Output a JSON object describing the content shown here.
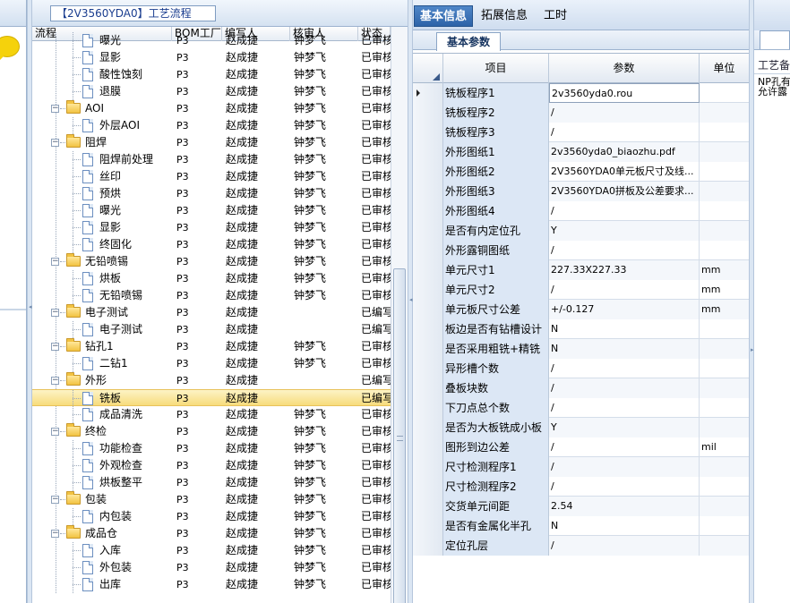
{
  "tree_pane": {
    "title": "【2V3560YDA0】工艺流程",
    "columns": [
      "流程",
      "BOM工厂",
      "编写人",
      "核审人",
      "状态"
    ],
    "rows": [
      {
        "name": "曝光",
        "level": 2,
        "bom": "P3",
        "writer": "赵成捷",
        "checker": "钟梦飞",
        "status": "已审核"
      },
      {
        "name": "显影",
        "level": 2,
        "bom": "P3",
        "writer": "赵成捷",
        "checker": "钟梦飞",
        "status": "已审核"
      },
      {
        "name": "酸性蚀刻",
        "level": 2,
        "bom": "P3",
        "writer": "赵成捷",
        "checker": "钟梦飞",
        "status": "已审核"
      },
      {
        "name": "退膜",
        "level": 2,
        "bom": "P3",
        "writer": "赵成捷",
        "checker": "钟梦飞",
        "status": "已审核"
      },
      {
        "name": "AOI",
        "level": 1,
        "bom": "P3",
        "writer": "赵成捷",
        "checker": "钟梦飞",
        "status": "已审核"
      },
      {
        "name": "外层AOI",
        "level": 2,
        "bom": "P3",
        "writer": "赵成捷",
        "checker": "钟梦飞",
        "status": "已审核"
      },
      {
        "name": "阻焊",
        "level": 1,
        "bom": "P3",
        "writer": "赵成捷",
        "checker": "钟梦飞",
        "status": "已审核"
      },
      {
        "name": "阻焊前处理",
        "level": 2,
        "bom": "P3",
        "writer": "赵成捷",
        "checker": "钟梦飞",
        "status": "已审核"
      },
      {
        "name": "丝印",
        "level": 2,
        "bom": "P3",
        "writer": "赵成捷",
        "checker": "钟梦飞",
        "status": "已审核"
      },
      {
        "name": "预烘",
        "level": 2,
        "bom": "P3",
        "writer": "赵成捷",
        "checker": "钟梦飞",
        "status": "已审核"
      },
      {
        "name": "曝光",
        "level": 2,
        "bom": "P3",
        "writer": "赵成捷",
        "checker": "钟梦飞",
        "status": "已审核"
      },
      {
        "name": "显影",
        "level": 2,
        "bom": "P3",
        "writer": "赵成捷",
        "checker": "钟梦飞",
        "status": "已审核"
      },
      {
        "name": "终固化",
        "level": 2,
        "bom": "P3",
        "writer": "赵成捷",
        "checker": "钟梦飞",
        "status": "已审核"
      },
      {
        "name": "无铅喷锡",
        "level": 1,
        "bom": "P3",
        "writer": "赵成捷",
        "checker": "钟梦飞",
        "status": "已审核"
      },
      {
        "name": "烘板",
        "level": 2,
        "bom": "P3",
        "writer": "赵成捷",
        "checker": "钟梦飞",
        "status": "已审核"
      },
      {
        "name": "无铅喷锡",
        "level": 2,
        "bom": "P3",
        "writer": "赵成捷",
        "checker": "钟梦飞",
        "status": "已审核"
      },
      {
        "name": "电子测试",
        "level": 1,
        "bom": "P3",
        "writer": "赵成捷",
        "checker": "",
        "status": "已编写"
      },
      {
        "name": "电子测试",
        "level": 2,
        "bom": "P3",
        "writer": "赵成捷",
        "checker": "",
        "status": "已编写"
      },
      {
        "name": "钻孔1",
        "level": 1,
        "bom": "P3",
        "writer": "赵成捷",
        "checker": "钟梦飞",
        "status": "已审核"
      },
      {
        "name": "二钻1",
        "level": 2,
        "bom": "P3",
        "writer": "赵成捷",
        "checker": "钟梦飞",
        "status": "已审核"
      },
      {
        "name": "外形",
        "level": 1,
        "bom": "P3",
        "writer": "赵成捷",
        "checker": "",
        "status": "已编写"
      },
      {
        "name": "铣板",
        "level": 2,
        "bom": "P3",
        "writer": "赵成捷",
        "checker": "",
        "status": "已编写",
        "selected": true
      },
      {
        "name": "成品清洗",
        "level": 2,
        "bom": "P3",
        "writer": "赵成捷",
        "checker": "钟梦飞",
        "status": "已审核"
      },
      {
        "name": "终检",
        "level": 1,
        "bom": "P3",
        "writer": "赵成捷",
        "checker": "钟梦飞",
        "status": "已审核"
      },
      {
        "name": "功能检查",
        "level": 2,
        "bom": "P3",
        "writer": "赵成捷",
        "checker": "钟梦飞",
        "status": "已审核"
      },
      {
        "name": "外观检查",
        "level": 2,
        "bom": "P3",
        "writer": "赵成捷",
        "checker": "钟梦飞",
        "status": "已审核"
      },
      {
        "name": "烘板整平",
        "level": 2,
        "bom": "P3",
        "writer": "赵成捷",
        "checker": "钟梦飞",
        "status": "已审核"
      },
      {
        "name": "包装",
        "level": 1,
        "bom": "P3",
        "writer": "赵成捷",
        "checker": "钟梦飞",
        "status": "已审核"
      },
      {
        "name": "内包装",
        "level": 2,
        "bom": "P3",
        "writer": "赵成捷",
        "checker": "钟梦飞",
        "status": "已审核"
      },
      {
        "name": "成品仓",
        "level": 1,
        "bom": "P3",
        "writer": "赵成捷",
        "checker": "钟梦飞",
        "status": "已审核"
      },
      {
        "name": "入库",
        "level": 2,
        "bom": "P3",
        "writer": "赵成捷",
        "checker": "钟梦飞",
        "status": "已审核"
      },
      {
        "name": "外包装",
        "level": 2,
        "bom": "P3",
        "writer": "赵成捷",
        "checker": "钟梦飞",
        "status": "已审核"
      },
      {
        "name": "出库",
        "level": 2,
        "bom": "P3",
        "writer": "赵成捷",
        "checker": "钟梦飞",
        "status": "已审核"
      }
    ]
  },
  "right_pane": {
    "tabs": [
      "基本信息",
      "拓展信息",
      "工时"
    ],
    "sub_tab": "基本参数",
    "grid_columns": [
      "项目",
      "参数",
      "单位"
    ],
    "rows": [
      {
        "item": "铣板程序1",
        "value": "2v3560yda0.rou",
        "unit": ""
      },
      {
        "item": "铣板程序2",
        "value": "/",
        "unit": ""
      },
      {
        "item": "铣板程序3",
        "value": "/",
        "unit": ""
      },
      {
        "item": "外形图纸1",
        "value": "2v3560yda0_biaozhu.pdf",
        "unit": ""
      },
      {
        "item": "外形图纸2",
        "value": "2V3560YDA0单元板尺寸及线...",
        "unit": ""
      },
      {
        "item": "外形图纸3",
        "value": "2V3560YDA0拼板及公差要求...",
        "unit": ""
      },
      {
        "item": "外形图纸4",
        "value": "/",
        "unit": ""
      },
      {
        "item": "是否有内定位孔",
        "value": "Y",
        "unit": ""
      },
      {
        "item": "外形露铜图纸",
        "value": "/",
        "unit": ""
      },
      {
        "item": "单元尺寸1",
        "value": "227.33X227.33",
        "unit": "mm"
      },
      {
        "item": "单元尺寸2",
        "value": "/",
        "unit": "mm"
      },
      {
        "item": "单元板尺寸公差",
        "value": "+/-0.127",
        "unit": "mm"
      },
      {
        "item": "板边是否有钻槽设计",
        "value": "N",
        "unit": ""
      },
      {
        "item": "是否采用粗铣+精铣",
        "value": "N",
        "unit": ""
      },
      {
        "item": "异形槽个数",
        "value": "/",
        "unit": ""
      },
      {
        "item": "叠板块数",
        "value": "/",
        "unit": ""
      },
      {
        "item": "下刀点总个数",
        "value": "/",
        "unit": ""
      },
      {
        "item": "是否为大板铣成小板",
        "value": "Y",
        "unit": ""
      },
      {
        "item": "图形到边公差",
        "value": "/",
        "unit": "mil"
      },
      {
        "item": "尺寸检测程序1",
        "value": "/",
        "unit": ""
      },
      {
        "item": "尺寸检测程序2",
        "value": "/",
        "unit": ""
      },
      {
        "item": "交货单元间距",
        "value": "2.54",
        "unit": ""
      },
      {
        "item": "是否有金属化半孔",
        "value": "N",
        "unit": ""
      },
      {
        "item": "定位孔层",
        "value": "/",
        "unit": ""
      }
    ]
  },
  "far_right": {
    "title": "工艺备",
    "line1": "NP孔有",
    "line2": "允许露"
  },
  "icons": [
    "speech-bubble-icon",
    "folder-icon",
    "document-icon",
    "expander-icon"
  ],
  "colors": {
    "tab_active": "#2d63a8",
    "selection": "#f7dc7c",
    "bubble": "#f5d20c"
  }
}
